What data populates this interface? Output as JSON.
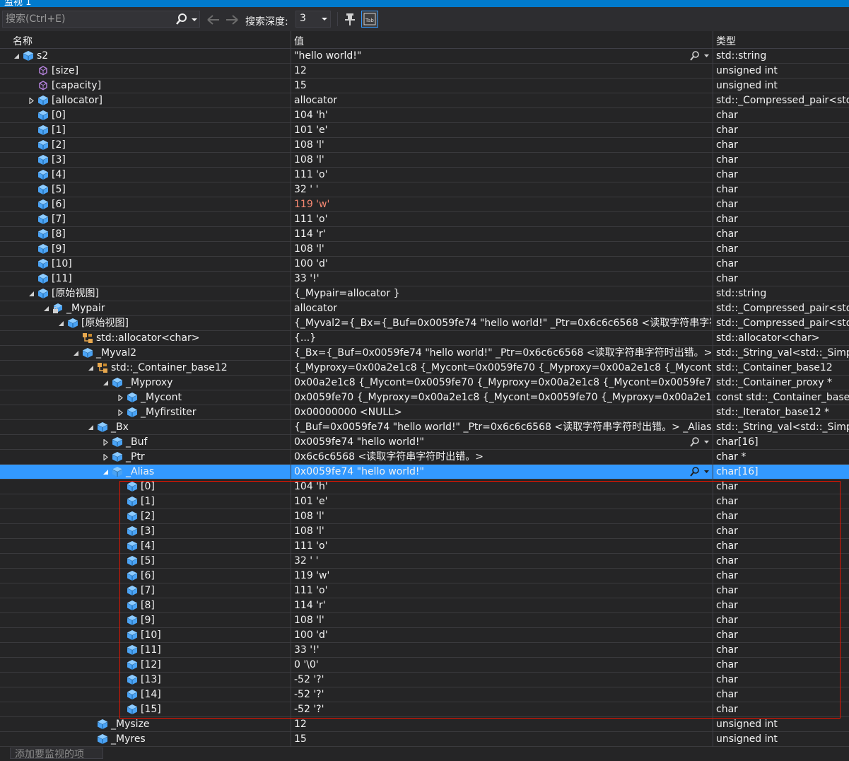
{
  "window": {
    "title": "监视 1"
  },
  "toolbar": {
    "search_placeholder": "搜索(Ctrl+E)",
    "depth_label": "搜索深度:",
    "depth_value": "3"
  },
  "columns": {
    "name": "名称",
    "value": "值",
    "type": "类型"
  },
  "colors": {
    "selection": "#3399ff",
    "changed_value": "#f48771",
    "highlight_border": "#e51400",
    "struct_icon": "#4aa3f5",
    "prop_icon": "#b180d7",
    "base_icon": "#e8a84e"
  },
  "rows": [
    {
      "depth": 0,
      "exp": "open",
      "icon": "cube",
      "name": "s2",
      "value": "\"hello world!\"",
      "type": "std::string",
      "mag": true
    },
    {
      "depth": 1,
      "exp": "none",
      "icon": "prop",
      "name": "[size]",
      "value": "12",
      "type": "unsigned int"
    },
    {
      "depth": 1,
      "exp": "none",
      "icon": "prop",
      "name": "[capacity]",
      "value": "15",
      "type": "unsigned int"
    },
    {
      "depth": 1,
      "exp": "closed",
      "icon": "cube",
      "name": "[allocator]",
      "value": "allocator",
      "type": "std::_Compressed_pair<std::..."
    },
    {
      "depth": 1,
      "exp": "none",
      "icon": "cube",
      "name": "[0]",
      "value": "104 'h'",
      "type": "char"
    },
    {
      "depth": 1,
      "exp": "none",
      "icon": "cube",
      "name": "[1]",
      "value": "101 'e'",
      "type": "char"
    },
    {
      "depth": 1,
      "exp": "none",
      "icon": "cube",
      "name": "[2]",
      "value": "108 'l'",
      "type": "char"
    },
    {
      "depth": 1,
      "exp": "none",
      "icon": "cube",
      "name": "[3]",
      "value": "108 'l'",
      "type": "char"
    },
    {
      "depth": 1,
      "exp": "none",
      "icon": "cube",
      "name": "[4]",
      "value": "111 'o'",
      "type": "char"
    },
    {
      "depth": 1,
      "exp": "none",
      "icon": "cube",
      "name": "[5]",
      "value": "32 ' '",
      "type": "char"
    },
    {
      "depth": 1,
      "exp": "none",
      "icon": "cube",
      "name": "[6]",
      "value": "119 'w'",
      "type": "char",
      "changed": true
    },
    {
      "depth": 1,
      "exp": "none",
      "icon": "cube",
      "name": "[7]",
      "value": "111 'o'",
      "type": "char"
    },
    {
      "depth": 1,
      "exp": "none",
      "icon": "cube",
      "name": "[8]",
      "value": "114 'r'",
      "type": "char"
    },
    {
      "depth": 1,
      "exp": "none",
      "icon": "cube",
      "name": "[9]",
      "value": "108 'l'",
      "type": "char"
    },
    {
      "depth": 1,
      "exp": "none",
      "icon": "cube",
      "name": "[10]",
      "value": "100 'd'",
      "type": "char"
    },
    {
      "depth": 1,
      "exp": "none",
      "icon": "cube",
      "name": "[11]",
      "value": "33 '!'",
      "type": "char"
    },
    {
      "depth": 1,
      "exp": "open",
      "icon": "cube",
      "name": "[原始视图]",
      "value": "{_Mypair=allocator }",
      "type": "std::string"
    },
    {
      "depth": 2,
      "exp": "open",
      "icon": "lock",
      "name": "_Mypair",
      "value": "allocator",
      "type": "std::_Compressed_pair<std::..."
    },
    {
      "depth": 3,
      "exp": "open",
      "icon": "cube",
      "name": "[原始视图]",
      "value": "{_Myval2={_Bx={_Buf=0x0059fe74 \"hello world!\" _Ptr=0x6c6c6568 <读取字符串字符时...",
      "type": "std::_Compressed_pair<std::..."
    },
    {
      "depth": 4,
      "exp": "none",
      "icon": "base",
      "name": "std::allocator<char>",
      "value": "{...}",
      "type": "std::allocator<char>"
    },
    {
      "depth": 4,
      "exp": "open",
      "icon": "cube",
      "name": "_Myval2",
      "value": "{_Bx={_Buf=0x0059fe74 \"hello world!\" _Ptr=0x6c6c6568 <读取字符串字符时出错。> _...",
      "type": "std::_String_val<std::_Simple..."
    },
    {
      "depth": 5,
      "exp": "open",
      "icon": "base",
      "name": "std::_Container_base12",
      "value": "{_Myproxy=0x00a2e1c8 {_Mycont=0x0059fe70 {_Myproxy=0x00a2e1c8 {_Mycont=0x005...",
      "type": "std::_Container_base12"
    },
    {
      "depth": 6,
      "exp": "open",
      "icon": "cube",
      "name": "_Myproxy",
      "value": "0x00a2e1c8 {_Mycont=0x0059fe70 {_Myproxy=0x00a2e1c8 {_Mycont=0x0059fe70 {_Myp...",
      "type": "std::_Container_proxy *"
    },
    {
      "depth": 7,
      "exp": "closed",
      "icon": "cube",
      "name": "_Mycont",
      "value": "0x0059fe70 {_Myproxy=0x00a2e1c8 {_Mycont=0x0059fe70 {_Myproxy=0x00a2e1c8 {_My...",
      "type": "const std::_Container_base1..."
    },
    {
      "depth": 7,
      "exp": "closed",
      "icon": "cube",
      "name": "_Myfirstiter",
      "value": "0x00000000 <NULL>",
      "type": "std::_Iterator_base12 *"
    },
    {
      "depth": 5,
      "exp": "open",
      "icon": "cube",
      "name": "_Bx",
      "value": "{_Buf=0x0059fe74 \"hello world!\" _Ptr=0x6c6c6568 <读取字符串字符时出错。> _Alias=...",
      "type": "std::_String_val<std::_Simple..."
    },
    {
      "depth": 6,
      "exp": "closed",
      "icon": "cube",
      "name": "_Buf",
      "value": "0x0059fe74 \"hello world!\"",
      "type": "char[16]",
      "mag": true
    },
    {
      "depth": 6,
      "exp": "closed",
      "icon": "cube",
      "name": "_Ptr",
      "value": "0x6c6c6568 <读取字符串字符时出错。>",
      "type": "char *"
    },
    {
      "depth": 6,
      "exp": "open",
      "icon": "cube",
      "name": "_Alias",
      "value": "0x0059fe74 \"hello world!\"",
      "type": "char[16]",
      "mag": true,
      "selected": true
    },
    {
      "depth": 7,
      "exp": "none",
      "icon": "cube",
      "name": "[0]",
      "value": "104 'h'",
      "type": "char"
    },
    {
      "depth": 7,
      "exp": "none",
      "icon": "cube",
      "name": "[1]",
      "value": "101 'e'",
      "type": "char"
    },
    {
      "depth": 7,
      "exp": "none",
      "icon": "cube",
      "name": "[2]",
      "value": "108 'l'",
      "type": "char"
    },
    {
      "depth": 7,
      "exp": "none",
      "icon": "cube",
      "name": "[3]",
      "value": "108 'l'",
      "type": "char"
    },
    {
      "depth": 7,
      "exp": "none",
      "icon": "cube",
      "name": "[4]",
      "value": "111 'o'",
      "type": "char"
    },
    {
      "depth": 7,
      "exp": "none",
      "icon": "cube",
      "name": "[5]",
      "value": "32 ' '",
      "type": "char"
    },
    {
      "depth": 7,
      "exp": "none",
      "icon": "cube",
      "name": "[6]",
      "value": "119 'w'",
      "type": "char"
    },
    {
      "depth": 7,
      "exp": "none",
      "icon": "cube",
      "name": "[7]",
      "value": "111 'o'",
      "type": "char"
    },
    {
      "depth": 7,
      "exp": "none",
      "icon": "cube",
      "name": "[8]",
      "value": "114 'r'",
      "type": "char"
    },
    {
      "depth": 7,
      "exp": "none",
      "icon": "cube",
      "name": "[9]",
      "value": "108 'l'",
      "type": "char"
    },
    {
      "depth": 7,
      "exp": "none",
      "icon": "cube",
      "name": "[10]",
      "value": "100 'd'",
      "type": "char"
    },
    {
      "depth": 7,
      "exp": "none",
      "icon": "cube",
      "name": "[11]",
      "value": "33 '!'",
      "type": "char"
    },
    {
      "depth": 7,
      "exp": "none",
      "icon": "cube",
      "name": "[12]",
      "value": "0 '\\0'",
      "type": "char"
    },
    {
      "depth": 7,
      "exp": "none",
      "icon": "cube",
      "name": "[13]",
      "value": "-52 '?'",
      "type": "char"
    },
    {
      "depth": 7,
      "exp": "none",
      "icon": "cube",
      "name": "[14]",
      "value": "-52 '?'",
      "type": "char"
    },
    {
      "depth": 7,
      "exp": "none",
      "icon": "cube",
      "name": "[15]",
      "value": "-52 '?'",
      "type": "char"
    },
    {
      "depth": 5,
      "exp": "none",
      "icon": "cube",
      "name": "_Mysize",
      "value": "12",
      "type": "unsigned int"
    },
    {
      "depth": 5,
      "exp": "none",
      "icon": "cube",
      "name": "_Myres",
      "value": "15",
      "type": "unsigned int"
    }
  ],
  "add_item_placeholder": "添加要监视的项"
}
